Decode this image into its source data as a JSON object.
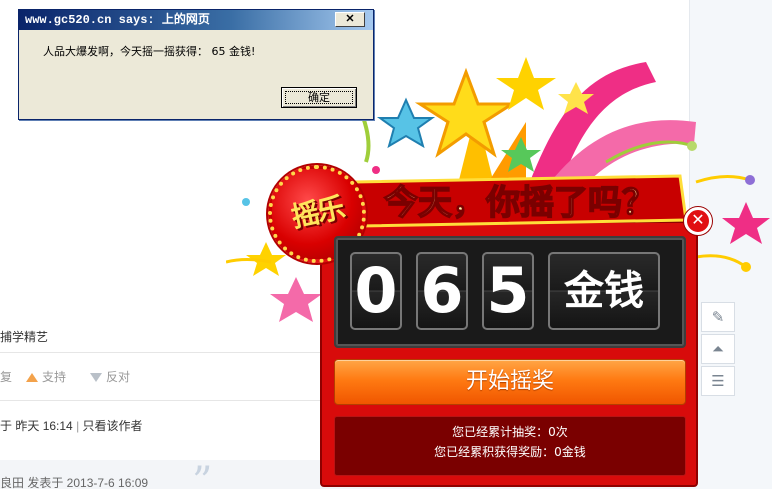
{
  "forum": {
    "snippet": "捕学精艺",
    "vote_prefix": "复",
    "support_label": "支持",
    "oppose_label": "反对",
    "poster_prefix": "于",
    "post_time": "昨天 16:14",
    "only_author": "只看该作者",
    "next_post": "良田 发表于 2013-7-6 16:09"
  },
  "dialog": {
    "title": "www.gc520.cn says: 上的网页",
    "message": "人品大爆发啊，今天摇一摇获得： 65 金钱!",
    "ok_label": "确定",
    "close_glyph": "✕"
  },
  "lottery": {
    "badge": "摇乐",
    "headline": "今天，你摇了吗？",
    "digits": [
      "0",
      "6",
      "5"
    ],
    "unit": "金钱",
    "start_label": "开始摇奖",
    "total_draws": "您已经累计抽奖：0次",
    "total_reward": "您已经累积获得奖励：0金钱",
    "close_glyph": "✕"
  },
  "colors": {
    "panel_red": "#d80b0b",
    "button_orange": "#ff7a12",
    "dialog_title_blue": "#0a246a"
  }
}
